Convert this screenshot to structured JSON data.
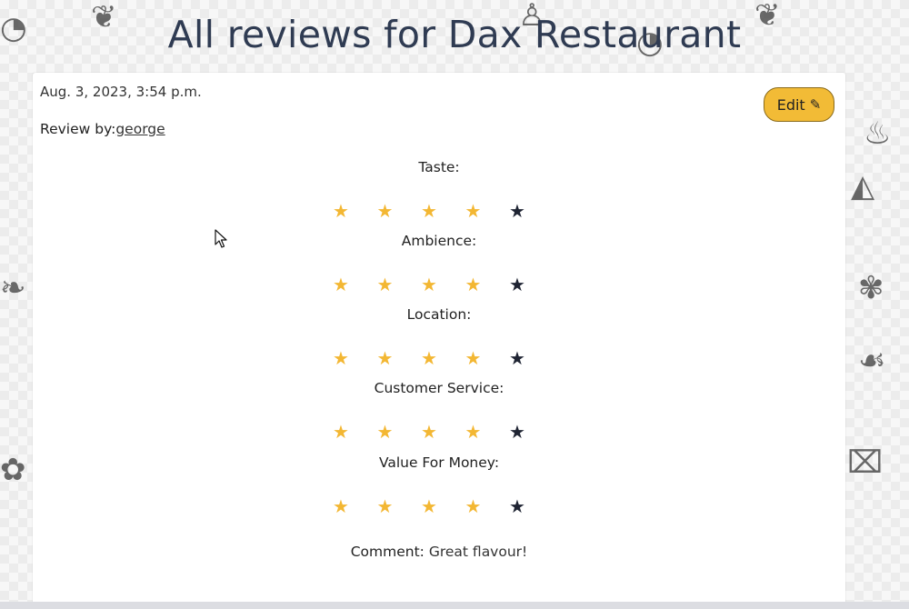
{
  "page": {
    "title": "All reviews for Dax Restaurant"
  },
  "review": {
    "date": "Aug. 3, 2023, 3:54 p.m.",
    "by_label": "Review by:",
    "author": "george",
    "edit_label": "Edit",
    "edit_icon": "pencil-icon",
    "ratings": [
      {
        "label": "Taste:",
        "score": 4,
        "max": 5
      },
      {
        "label": "Ambience:",
        "score": 4,
        "max": 5
      },
      {
        "label": "Location:",
        "score": 4,
        "max": 5
      },
      {
        "label": "Customer Service:",
        "score": 4,
        "max": 5
      },
      {
        "label": "Value For Money:",
        "score": 4,
        "max": 5
      }
    ],
    "comment_label": "Comment:",
    "comment_text": "Great flavour!"
  },
  "colors": {
    "accent": "#f2bb36",
    "star_filled": "#f3b733",
    "star_empty": "#1f2433",
    "title": "#2f3b52"
  }
}
